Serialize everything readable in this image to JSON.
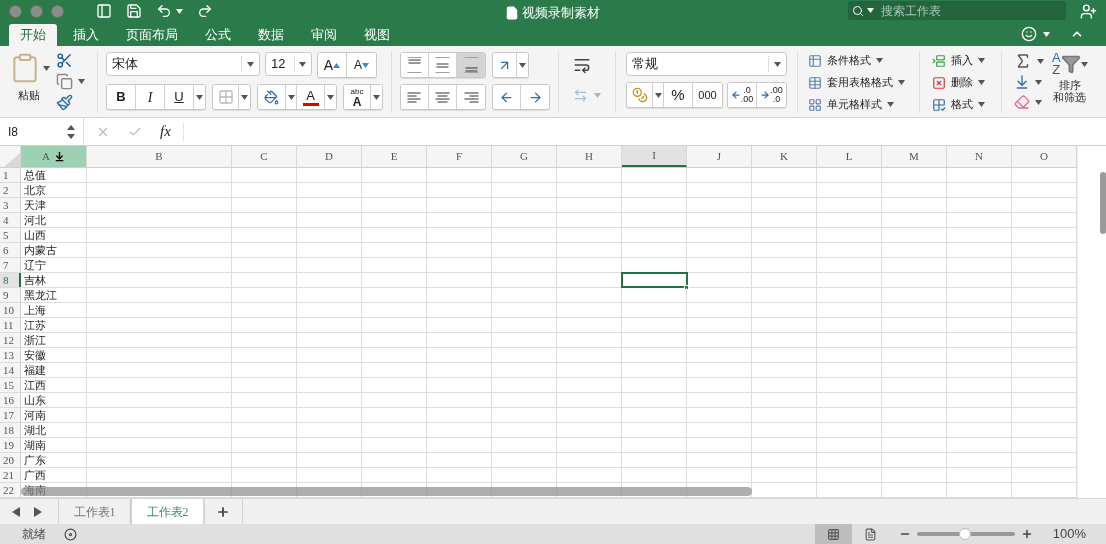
{
  "window": {
    "title": "视频录制素材"
  },
  "search": {
    "placeholder": "搜索工作表"
  },
  "tabs": [
    {
      "label": "开始",
      "selected": true
    },
    {
      "label": "插入",
      "selected": false
    },
    {
      "label": "页面布局",
      "selected": false
    },
    {
      "label": "公式",
      "selected": false
    },
    {
      "label": "数据",
      "selected": false
    },
    {
      "label": "审阅",
      "selected": false
    },
    {
      "label": "视图",
      "selected": false
    }
  ],
  "ribbon": {
    "paste": {
      "label": "粘贴"
    },
    "font": {
      "name": "宋体",
      "size": "12",
      "grow": "A",
      "shrink": "A",
      "bold": "B",
      "italic": "I",
      "underline": "U",
      "font_color": "A",
      "clear_top": "abc",
      "clear_bottom": "A"
    },
    "vertical_align": [
      {
        "kind": "top",
        "selected": false
      },
      {
        "kind": "middle",
        "selected": false
      },
      {
        "kind": "bottom",
        "selected": true
      }
    ],
    "horizontal_align": [
      {
        "kind": "left"
      },
      {
        "kind": "center"
      },
      {
        "kind": "right"
      }
    ],
    "merge": {
      "disabled": true
    },
    "number": {
      "format": "常规",
      "percent": "%",
      "thousands": "000",
      "increase_top": ".0",
      "increase_bottom": ".00",
      "decrease_top": ".00",
      "decrease_bottom": ".0"
    },
    "styles": [
      {
        "kind": "conditional",
        "label": "条件格式"
      },
      {
        "kind": "table",
        "label": "套用表格格式"
      },
      {
        "kind": "cell",
        "label": "单元格样式"
      }
    ],
    "cells": [
      {
        "kind": "insert",
        "label": "插入"
      },
      {
        "kind": "delete",
        "label": "删除"
      },
      {
        "kind": "format",
        "label": "格式"
      }
    ],
    "sort": {
      "letter_top": "A",
      "letter_bottom": "Z",
      "label_lines": [
        "排序",
        "和筛选"
      ]
    }
  },
  "formula_bar": {
    "name_box": "I8",
    "fx": "fx"
  },
  "columns": [
    {
      "label": "A",
      "hovered": true,
      "active": false
    },
    {
      "label": "B",
      "hovered": false,
      "active": false
    },
    {
      "label": "C",
      "hovered": false,
      "active": false
    },
    {
      "label": "D",
      "hovered": false,
      "active": false
    },
    {
      "label": "E",
      "hovered": false,
      "active": false
    },
    {
      "label": "F",
      "hovered": false,
      "active": false
    },
    {
      "label": "G",
      "hovered": false,
      "active": false
    },
    {
      "label": "H",
      "hovered": false,
      "active": false
    },
    {
      "label": "I",
      "hovered": false,
      "active": true
    },
    {
      "label": "J",
      "hovered": false,
      "active": false
    },
    {
      "label": "K",
      "hovered": false,
      "active": false
    },
    {
      "label": "L",
      "hovered": false,
      "active": false
    },
    {
      "label": "M",
      "hovered": false,
      "active": false
    },
    {
      "label": "N",
      "hovered": false,
      "active": false
    },
    {
      "label": "O",
      "hovered": false,
      "active": false
    }
  ],
  "rows": [
    {
      "number": "1",
      "a": "总值",
      "active": false
    },
    {
      "number": "2",
      "a": "北京",
      "active": false
    },
    {
      "number": "3",
      "a": "天津",
      "active": false
    },
    {
      "number": "4",
      "a": "河北",
      "active": false
    },
    {
      "number": "5",
      "a": "山西",
      "active": false
    },
    {
      "number": "6",
      "a": "内蒙古",
      "active": false
    },
    {
      "number": "7",
      "a": "辽宁",
      "active": false
    },
    {
      "number": "8",
      "a": "吉林",
      "active": true
    },
    {
      "number": "9",
      "a": "黑龙江",
      "active": false
    },
    {
      "number": "10",
      "a": "上海",
      "active": false
    },
    {
      "number": "11",
      "a": "江苏",
      "active": false
    },
    {
      "number": "12",
      "a": "浙江",
      "active": false
    },
    {
      "number": "13",
      "a": "安徽",
      "active": false
    },
    {
      "number": "14",
      "a": "福建",
      "active": false
    },
    {
      "number": "15",
      "a": "江西",
      "active": false
    },
    {
      "number": "16",
      "a": "山东",
      "active": false
    },
    {
      "number": "17",
      "a": "河南",
      "active": false
    },
    {
      "number": "18",
      "a": "湖北",
      "active": false
    },
    {
      "number": "19",
      "a": "湖南",
      "active": false
    },
    {
      "number": "20",
      "a": "广东",
      "active": false
    },
    {
      "number": "21",
      "a": "广西",
      "active": false
    },
    {
      "number": "22",
      "a": "海南",
      "active": false
    }
  ],
  "sheets": [
    {
      "label": "工作表1",
      "selected": false
    },
    {
      "label": "工作表2",
      "selected": true
    }
  ],
  "status": {
    "text": "就绪",
    "views": [
      {
        "kind": "normal",
        "selected": true
      },
      {
        "kind": "page_layout",
        "selected": false
      }
    ],
    "zoom": {
      "level": 0.49,
      "reading": "100%"
    }
  }
}
